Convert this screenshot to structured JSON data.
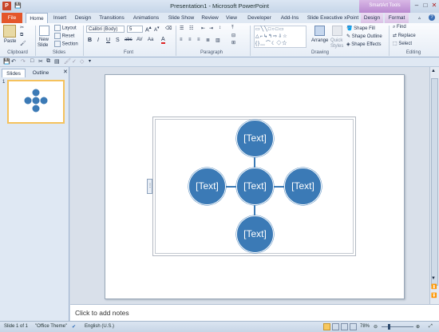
{
  "window": {
    "title": "Presentation1 - Microsoft PowerPoint",
    "app_icon_letter": "P",
    "context_band": "SmartArt Tools"
  },
  "tabs": [
    {
      "label": "File"
    },
    {
      "label": "Home"
    },
    {
      "label": "Insert"
    },
    {
      "label": "Design"
    },
    {
      "label": "Transitions"
    },
    {
      "label": "Animations"
    },
    {
      "label": "Slide Show"
    },
    {
      "label": "Review"
    },
    {
      "label": "View"
    },
    {
      "label": "Developer"
    },
    {
      "label": "Add-Ins"
    },
    {
      "label": "Slide Executive xPoint"
    },
    {
      "label": "Design"
    },
    {
      "label": "Format"
    }
  ],
  "ribbon": {
    "clipboard": {
      "paste": "Paste",
      "group": "Clipboard"
    },
    "slides": {
      "new_slide": "New",
      "new_slide2": "Slide",
      "layout": "Layout",
      "reset": "Reset",
      "section": "Section",
      "group": "Slides"
    },
    "font": {
      "name": "Calibri (Body)",
      "size": "5",
      "bold": "B",
      "italic": "I",
      "underline": "U",
      "strike": "S",
      "shadow": "abc",
      "group": "Font"
    },
    "paragraph": {
      "group": "Paragraph"
    },
    "drawing": {
      "arrange": "Arrange",
      "quick_styles": "Quick",
      "quick_styles2": "Styles",
      "shape_fill": "Shape Fill",
      "shape_outline": "Shape Outline",
      "shape_effects": "Shape Effects",
      "group": "Drawing"
    },
    "editing": {
      "find": "Find",
      "replace": "Replace",
      "select": "Select",
      "group": "Editing"
    }
  },
  "left_pane": {
    "tabs": [
      "Slides",
      "Outline"
    ],
    "slide_number": "1"
  },
  "diagram": {
    "nodes": [
      "[Text]",
      "[Text]",
      "[Text]",
      "[Text]",
      "[Text]"
    ],
    "color": "#3b7ab6"
  },
  "notes": {
    "placeholder": "Click to add notes"
  },
  "status": {
    "slide": "Slide 1 of 1",
    "theme": "\"Office Theme\"",
    "language": "English (U.S.)",
    "zoom": "78%"
  },
  "colors": {
    "file_tab": "#e4562b",
    "accent": "#3b7ab6",
    "context": "#b98ad0"
  }
}
